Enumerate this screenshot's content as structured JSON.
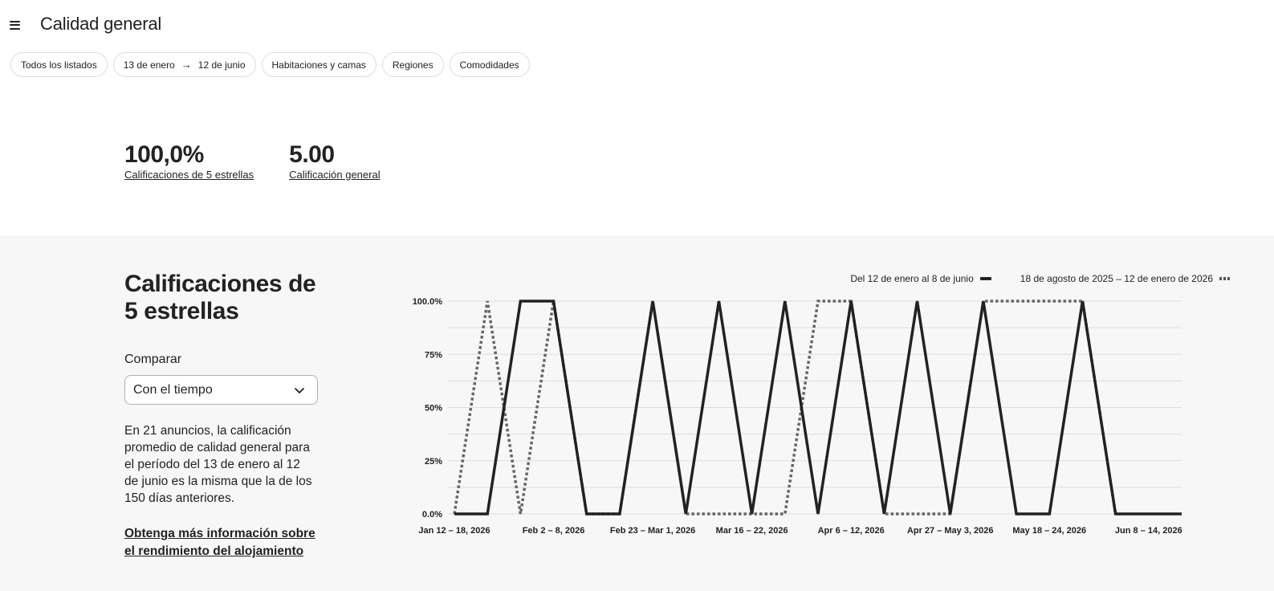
{
  "header": {
    "title": "Calidad general",
    "menu_icon": "hamburger-menu-icon"
  },
  "filters": {
    "all_listings": "Todos los listados",
    "date_from": "13 de enero",
    "date_to": "12 de junio",
    "rooms": "Habitaciones y camas",
    "regions": "Regiones",
    "amenities": "Comodidades"
  },
  "kpis": {
    "five_star_value": "100,0%",
    "five_star_label": "Calificaciones de 5 estrellas",
    "overall_value": "5.00",
    "overall_label": "Calificación general"
  },
  "section": {
    "title": "Calificaciones de 5 estrellas",
    "compare_label": "Comparar",
    "compare_selected": "Con el tiempo",
    "description": "En 21 anuncios, la calificación promedio de calidad general para el período del 13 de enero al 12 de junio es la misma que la de los 150 días anteriores.",
    "link": "Obtenga más información sobre el rendimiento del alojamiento"
  },
  "chart_data": {
    "type": "line",
    "ylim": [
      0,
      100
    ],
    "y_ticks": [
      "0.0%",
      "25%",
      "50%",
      "75%",
      "100.0%"
    ],
    "y_tick_values": [
      0,
      25,
      50,
      75,
      100
    ],
    "x_tick_labels": [
      "Jan 12 – 18, 2026",
      "Feb 2 – 8, 2026",
      "Feb 23 – Mar 1, 2026",
      "Mar 16 – 22, 2026",
      "Apr 6 – 12, 2026",
      "Apr 27 – May 3, 2026",
      "May 18 – 24, 2026",
      "Jun 8 – 14, 2026"
    ],
    "x_tick_index": [
      0,
      3,
      6,
      9,
      12,
      15,
      18,
      21
    ],
    "grid": true,
    "legend_position": "top-right",
    "series": [
      {
        "name": "Del 12 de enero al 8 de junio",
        "style": "solid",
        "color": "#222222",
        "values": [
          0,
          0,
          100,
          100,
          0,
          0,
          100,
          0,
          100,
          0,
          100,
          0,
          100,
          0,
          100,
          0,
          100,
          0,
          0,
          100,
          0,
          0,
          0
        ]
      },
      {
        "name": "18 de agosto de 2025 – 12 de enero de 2026",
        "style": "dotted",
        "color": "#666666",
        "values": [
          0,
          100,
          0,
          100,
          0,
          0,
          100,
          0,
          0,
          0,
          0,
          100,
          100,
          0,
          0,
          0,
          100,
          100,
          100,
          100,
          0
        ]
      }
    ]
  }
}
